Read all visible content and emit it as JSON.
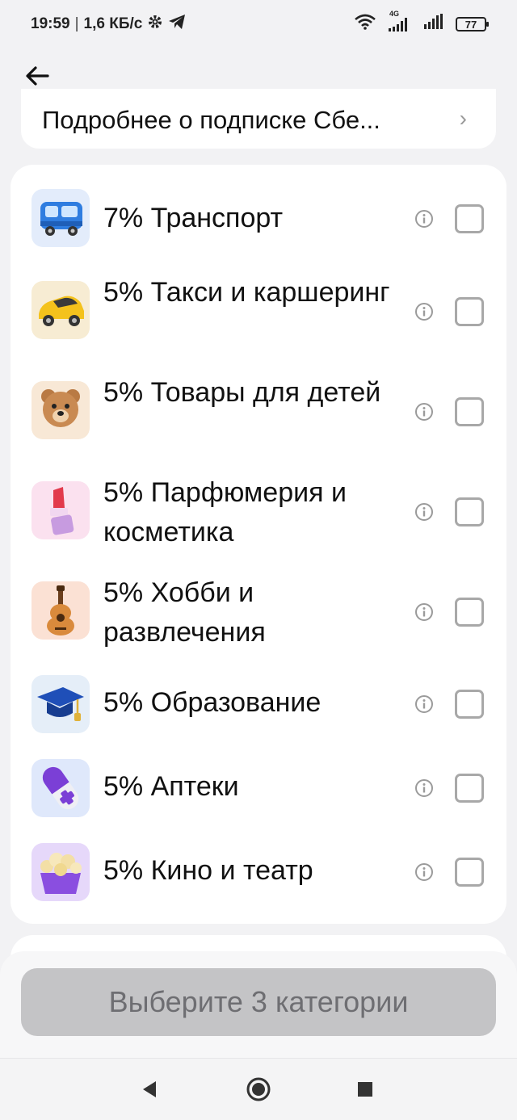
{
  "status": {
    "time": "19:59",
    "separator": "|",
    "speed": "1,6 КБ/с",
    "network": "4G",
    "battery": "77"
  },
  "header": {
    "back_icon": "arrow-left-icon"
  },
  "subscription": {
    "text": "Подробнее о подписке Сбе...",
    "chevron": "›"
  },
  "categories": [
    {
      "label": "7% Транспорт",
      "icon": "bus-icon"
    },
    {
      "label": "5% Такси и каршеринг",
      "icon": "car-icon"
    },
    {
      "label": "5% Товары для детей",
      "icon": "teddy-bear-icon"
    },
    {
      "label": "5% Парфюмерия и косметика",
      "icon": "lipstick-icon"
    },
    {
      "label": "5% Хобби и развлечения",
      "icon": "guitar-icon"
    },
    {
      "label": "5% Образование",
      "icon": "graduation-cap-icon"
    },
    {
      "label": "5% Аптеки",
      "icon": "pill-icon"
    },
    {
      "label": "5% Кино и театр",
      "icon": "popcorn-icon"
    }
  ],
  "action": {
    "label": "Выберите 3 категории"
  },
  "colors": {
    "background": "#f2f2f4",
    "card": "#ffffff",
    "button_disabled": "#c4c4c6",
    "button_text_disabled": "#6e6e72"
  }
}
